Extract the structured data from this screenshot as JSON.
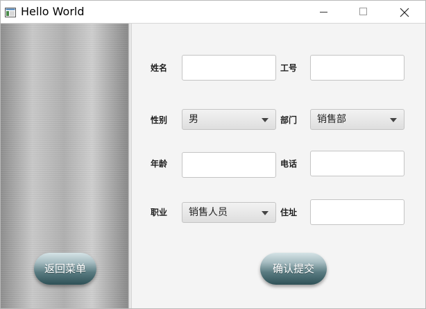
{
  "window": {
    "title": "Hello World"
  },
  "left_panel": {
    "back_button": "返回菜单"
  },
  "form": {
    "name_label": "姓名",
    "name_value": "",
    "employee_id_label": "工号",
    "employee_id_value": "",
    "gender_label": "性别",
    "gender_selected": "男",
    "department_label": "部门",
    "department_selected": "销售部",
    "age_label": "年龄",
    "age_value": "",
    "phone_label": "电话",
    "phone_value": "",
    "occupation_label": "职业",
    "occupation_selected": "销售人员",
    "address_label": "住址",
    "address_value": "",
    "submit_button": "确认提交"
  },
  "colors": {
    "form_background": "#f4f4f4",
    "button_gradient_top": "#d5e3e6",
    "button_gradient_bottom": "#2f5157"
  }
}
